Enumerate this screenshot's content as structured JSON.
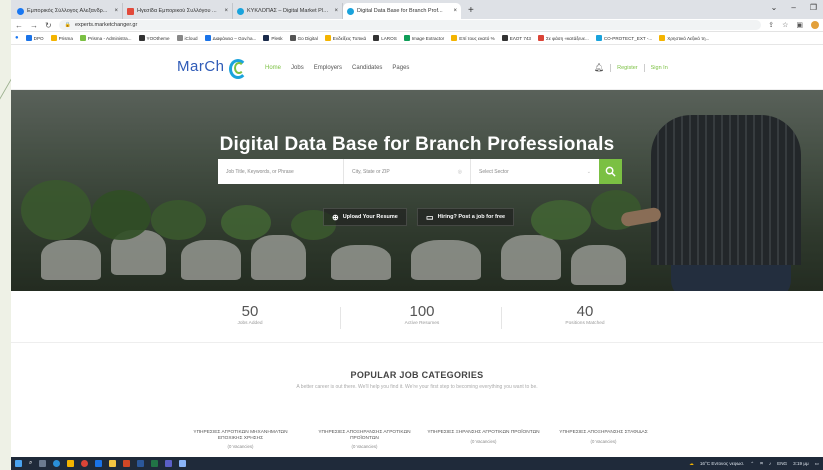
{
  "browser": {
    "tabs": [
      {
        "label": "Εμπορικός Σύλλογος Αλεξανδρ...",
        "color": "#1877f2"
      },
      {
        "label": "Ηγεσίδα Εμπορικού Συλλόγου ...",
        "color": "#e24a3b"
      },
      {
        "label": "ΚΥΚΛΟΠΑΣ – Digital Market Plat...",
        "color": "#1aa3dc"
      },
      {
        "label": "Digital Data Base for Branch Prof...",
        "color": "#1aa3dc",
        "active": true
      }
    ],
    "new_tab": "+",
    "url": "experts.marketchanger.gr",
    "bookmarks": [
      {
        "label": "DPO",
        "color": "#1a73e8"
      },
      {
        "label": "Prisma",
        "color": "#f4b400"
      },
      {
        "label": "Prisma - Administra...",
        "color": "#7bc043"
      },
      {
        "label": "YOOtheme",
        "color": "#333333"
      },
      {
        "label": "iCloud",
        "color": "#888888"
      },
      {
        "label": "Διαφάνεια – Gov.ha...",
        "color": "#1a73e8"
      },
      {
        "label": "Plesk",
        "color": "#1a2a4a"
      },
      {
        "label": "Go Digital",
        "color": "#555555"
      },
      {
        "label": "Ενδείξεις Τοπικά",
        "color": "#f4b400"
      },
      {
        "label": "LAROS",
        "color": "#333333"
      },
      {
        "label": "Image Extractor",
        "color": "#0f9d58"
      },
      {
        "label": "Επί τους εκατό %",
        "color": "#f4b400"
      },
      {
        "label": "ΕΛΟΤ 743",
        "color": "#333333"
      },
      {
        "label": "Σε φάση «κατάξευε...",
        "color": "#db4437"
      },
      {
        "label": "CO-PROTECT_EXT -...",
        "color": "#1aa3dc"
      },
      {
        "label": "Χρηστικό Λεξικό τη...",
        "color": "#f4b400"
      }
    ]
  },
  "site": {
    "logo": "MarCh",
    "nav": [
      {
        "label": "Home",
        "active": true
      },
      {
        "label": "Jobs"
      },
      {
        "label": "Employers"
      },
      {
        "label": "Candidates"
      },
      {
        "label": "Pages"
      }
    ],
    "register": "Register",
    "signin": "Sign In",
    "accent": "#7bc043"
  },
  "hero": {
    "title": "Digital Data Base for Branch Professionals",
    "search": {
      "keyword_placeholder": "Job Title, Keywords, or Phrase",
      "location_placeholder": "City, State or ZIP",
      "sector_placeholder": "Select Sector"
    },
    "upload_label": "Upload Your Resume",
    "hiring_label": "Hiring? Post a job for free"
  },
  "stats": [
    {
      "num": "50",
      "label": "Jobs Added"
    },
    {
      "num": "100",
      "label": "Active Resumes"
    },
    {
      "num": "40",
      "label": "Positions Matched"
    }
  ],
  "categories": {
    "title": "POPULAR JOB CATEGORIES",
    "subtitle": "A better career is out there. We'll help you find it. We're your first step to becoming everything you want to be.",
    "items": [
      {
        "name": "ΥΠΗΡΕΣΙΕΣ ΑΓΡΟΤΙΚΩΝ ΜΗΧΑΝΗΜΑΤΩΝ ΕΠΟΧΙΚΗΣ ΧΡΗΣΗΣ",
        "count": "(0 Vacancies)"
      },
      {
        "name": "ΥΠΗΡΕΣΙΕΣ ΑΠΟΞΗΡΑΝΣΗΣ ΑΓΡΟΤΙΚΩΝ ΠΡΟΪΟΝΤΩΝ",
        "count": "(0 Vacancies)"
      },
      {
        "name": "ΥΠΗΡΕΣΙΕΣ ΞΗΡΑΝΣΗΣ ΑΓΡΟΤΙΚΩΝ ΠΡΟΪΟΝΤΩΝ",
        "count": "(0 Vacancies)"
      },
      {
        "name": "ΥΠΗΡΕΣΙΕΣ ΑΠΟΞΗΡΑΝΣΗΣ ΣΤΑΦΙΔΑΣ",
        "count": "(0 Vacancies)"
      }
    ]
  },
  "taskbar": {
    "weather": "16°C Εντονος νεφωσ.",
    "lang": "ENG",
    "time": "3:19 μμ"
  }
}
